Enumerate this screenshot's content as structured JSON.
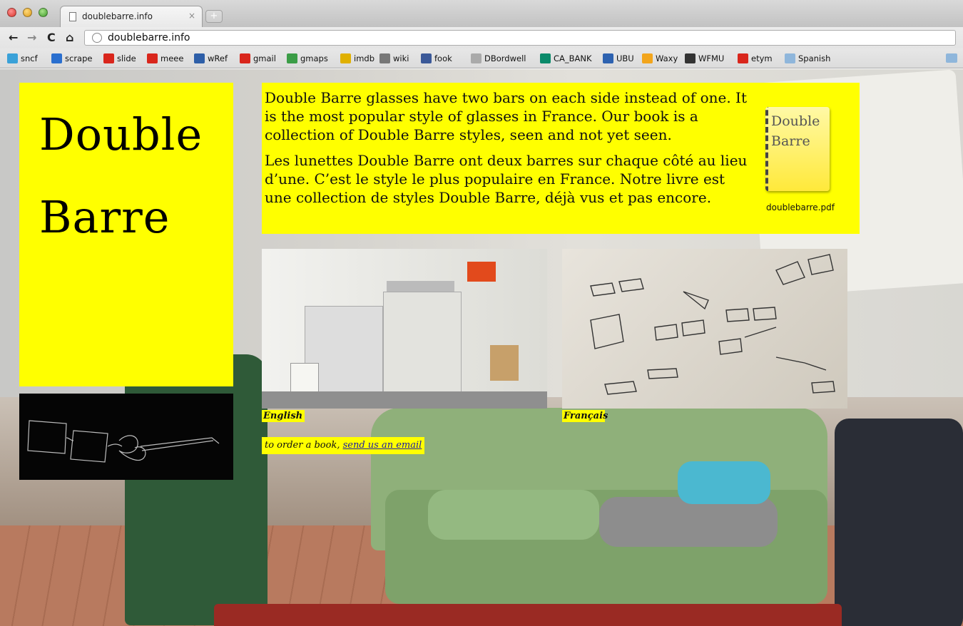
{
  "browser": {
    "tab_title": "doubleba​rre.info",
    "tab_close": "×",
    "new_tab": "+",
    "url": "doublebarre.info",
    "nav": {
      "back": "←",
      "forward": "→",
      "reload": "C",
      "home": "⌂"
    }
  },
  "bookmarks": [
    {
      "label": "sncf",
      "icon": "sncf-icon",
      "color": "#3aa1d8"
    },
    {
      "label": "scrape",
      "icon": "scrape-icon",
      "color": "#2a6fcf"
    },
    {
      "label": "slide",
      "icon": "sfr-icon",
      "color": "#d9261c"
    },
    {
      "label": "meee",
      "icon": "sfr-icon",
      "color": "#d9261c"
    },
    {
      "label": "wRef",
      "icon": "wordreference-icon",
      "color": "#2e5fa8"
    },
    {
      "label": "gmail",
      "icon": "sfr-icon",
      "color": "#d9261c"
    },
    {
      "label": "gmaps",
      "icon": "gmaps-icon",
      "color": "#3b9d47"
    },
    {
      "label": "imdb",
      "icon": "imdb-icon",
      "color": "#e0b000"
    },
    {
      "label": "wiki",
      "icon": "wikipedia-icon",
      "color": "#777777"
    },
    {
      "label": "fook",
      "icon": "facebook-icon",
      "color": "#3b5998"
    },
    {
      "label": "DBordwell",
      "icon": "dbordwell-icon",
      "color": "#aaaaaa"
    },
    {
      "label": "CA_BANK",
      "icon": "ca-bank-icon",
      "color": "#0a8a6a"
    },
    {
      "label": "UBU",
      "icon": "ubu-icon",
      "color": "#2d62b0"
    },
    {
      "label": "Waxy",
      "icon": "waxy-icon",
      "color": "#f2a51c"
    },
    {
      "label": "WFMU",
      "icon": "wfmu-icon",
      "color": "#333333"
    },
    {
      "label": "etym",
      "icon": "sfr-icon",
      "color": "#d9261c"
    },
    {
      "label": "Spanish",
      "icon": "folder-icon",
      "color": "#8fb6db"
    }
  ],
  "site": {
    "logo_line1": "Double",
    "logo_line2": "Barre",
    "intro_en": "Double Barre glasses have two bars on each side instead of one.  It is the most popular style of glasses in France. Our book is a collection of Double Barre styles, seen and not yet seen.",
    "intro_fr": "Les lunettes Double Barre ont deux barres sur chaque côté au lieu d’une. C’est le style le plus populaire en France. Notre livre est une collection de styles Double Barre, déjà vus et pas encore.",
    "pdf_icon_line1": "Double",
    "pdf_icon_line2": "Barre",
    "pdf_label": "doublebarre.pdf",
    "caption_english": "English",
    "caption_french": "Français",
    "order_prefix": "to order a book, ",
    "order_link": "send us an email",
    "accent": "#ffff00",
    "link_color": "#1a1aa6"
  }
}
